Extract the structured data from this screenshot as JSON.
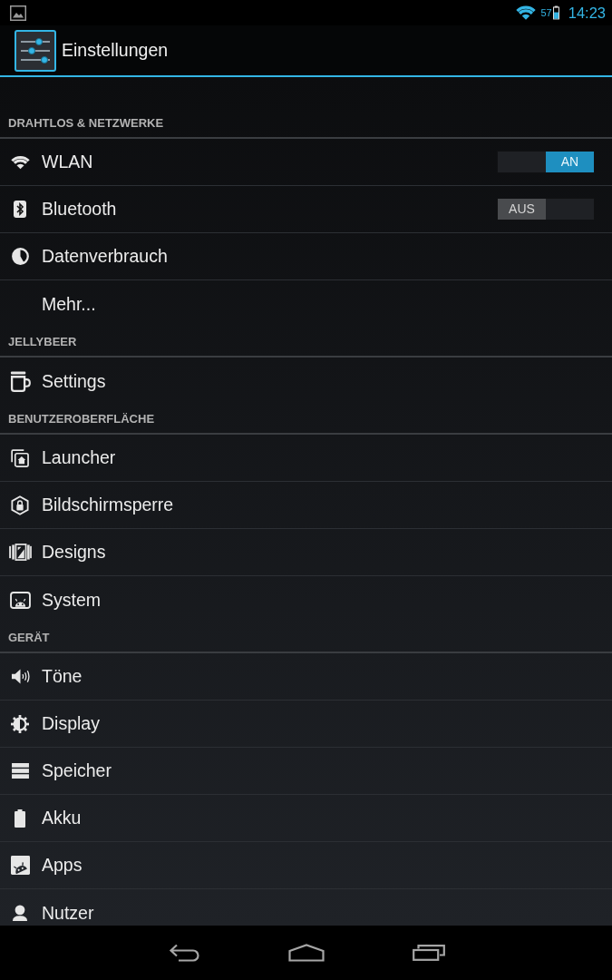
{
  "status_bar": {
    "battery_percent": "57",
    "time": "14:23"
  },
  "action_bar": {
    "title": "Einstellungen"
  },
  "sections": [
    {
      "header": "DRAHTLOS & NETZWERKE",
      "items": [
        {
          "kind": "switch",
          "label": "WLAN",
          "on": true,
          "switch_text": "AN"
        },
        {
          "kind": "switch",
          "label": "Bluetooth",
          "on": false,
          "switch_text": "AUS"
        },
        {
          "kind": "link",
          "label": "Datenverbrauch"
        },
        {
          "kind": "link",
          "label": "Mehr..."
        }
      ]
    },
    {
      "header": "JELLYBEER",
      "items": [
        {
          "kind": "link",
          "label": "Settings"
        }
      ]
    },
    {
      "header": "BENUTZEROBERFLÄCHE",
      "items": [
        {
          "kind": "link",
          "label": "Launcher"
        },
        {
          "kind": "link",
          "label": "Bildschirmsperre"
        },
        {
          "kind": "link",
          "label": "Designs"
        },
        {
          "kind": "link",
          "label": "System"
        }
      ]
    },
    {
      "header": "GERÄT",
      "items": [
        {
          "kind": "link",
          "label": "Töne"
        },
        {
          "kind": "link",
          "label": "Display"
        },
        {
          "kind": "link",
          "label": "Speicher"
        },
        {
          "kind": "link",
          "label": "Akku"
        },
        {
          "kind": "link",
          "label": "Apps"
        },
        {
          "kind": "link",
          "label": "Nutzer"
        }
      ]
    }
  ]
}
